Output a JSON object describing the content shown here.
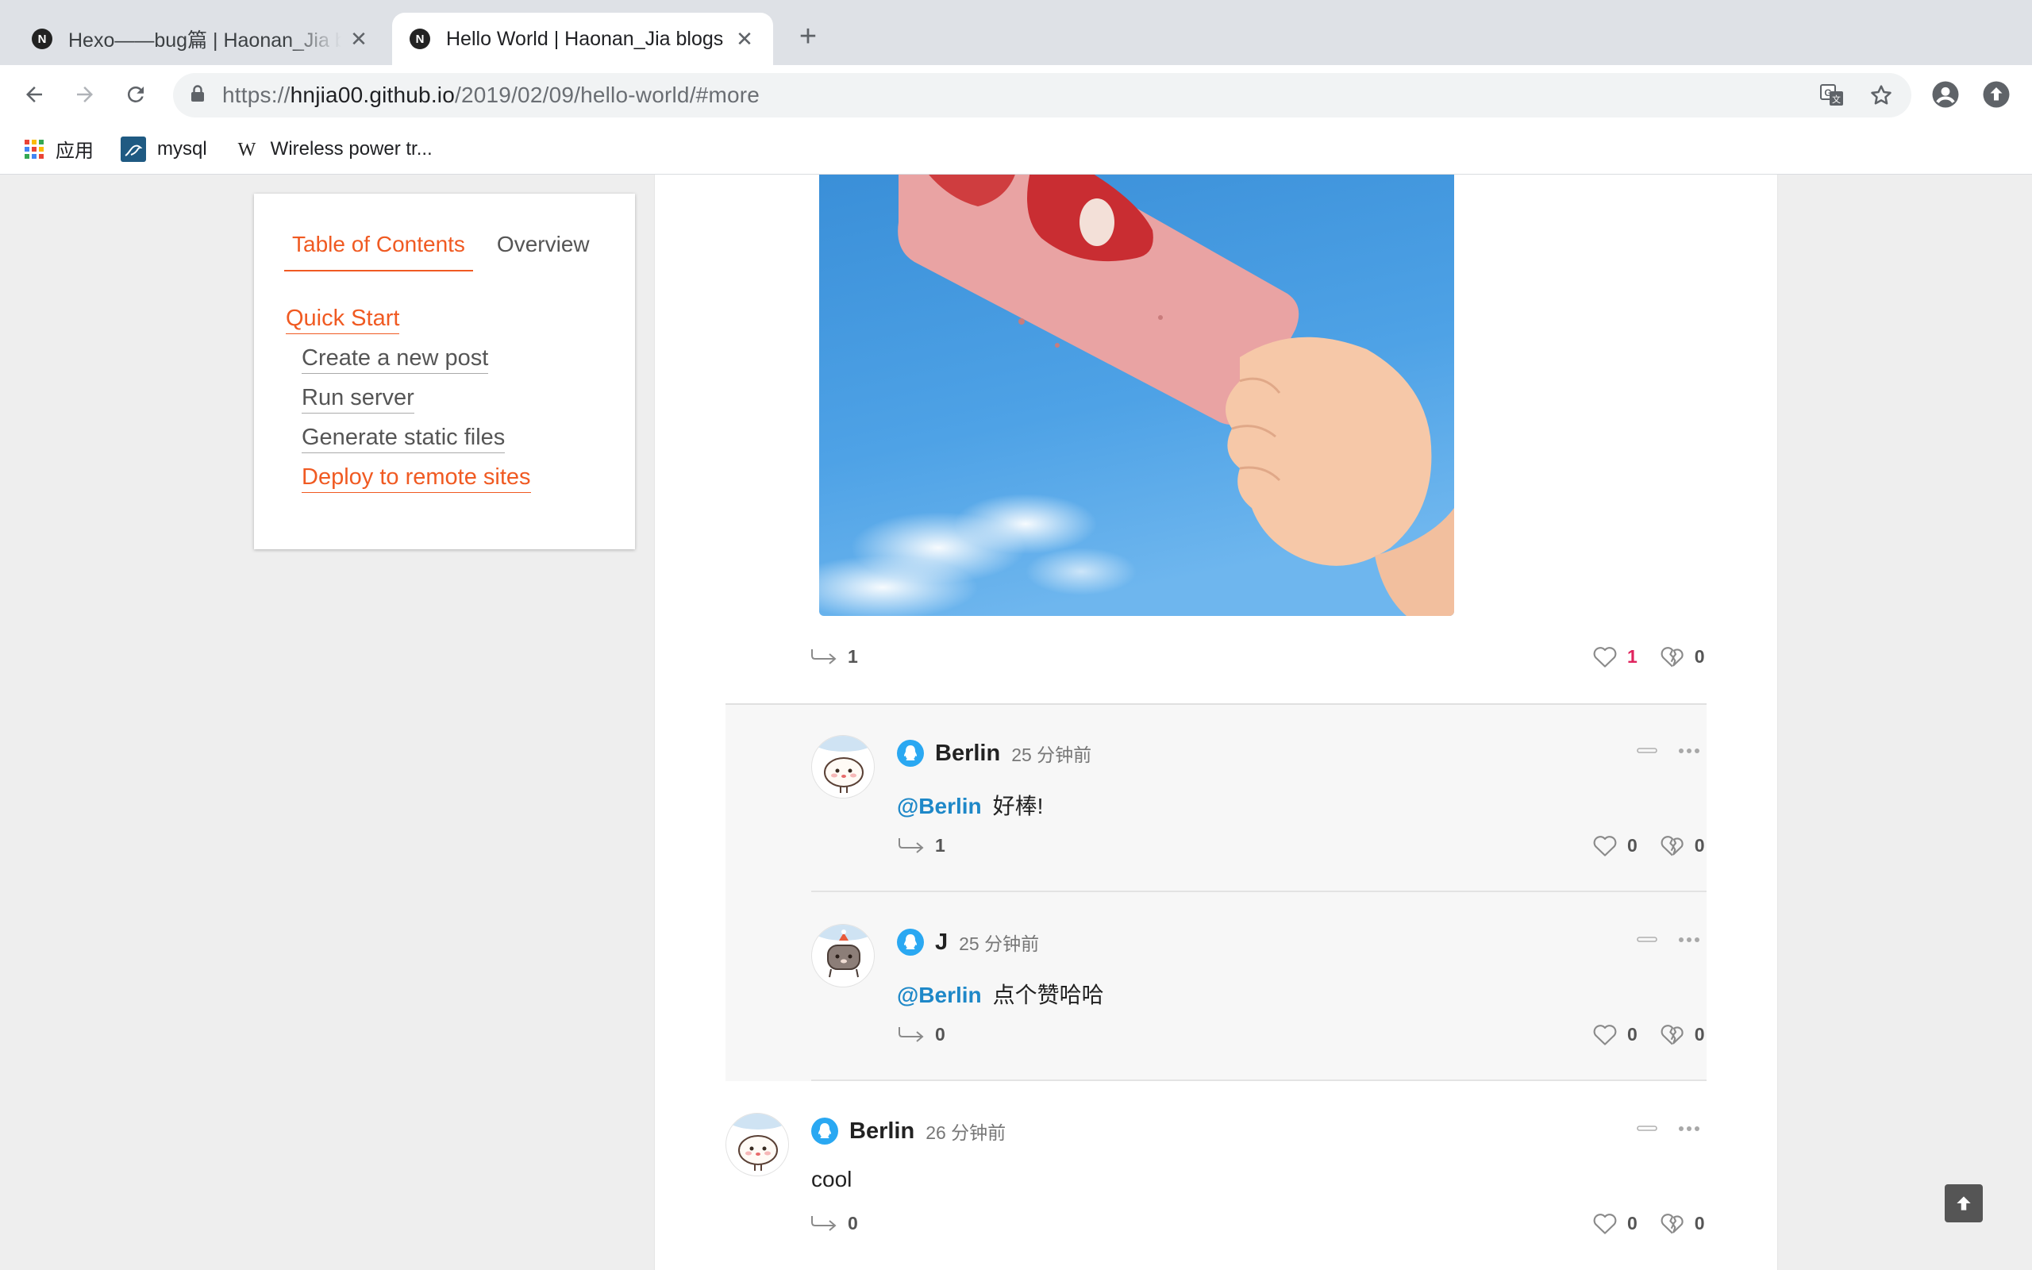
{
  "browser": {
    "tabs": [
      {
        "title": "Hexo——bug篇 | Haonan_Jia blogs",
        "favicon": "N",
        "close": "✕"
      },
      {
        "title": "Hello World | Haonan_Jia blogs",
        "favicon": "N",
        "close": "✕"
      }
    ],
    "new_tab": "+",
    "url": {
      "scheme": "https://",
      "host": "hnjia00.github.io",
      "path": "/2019/02/09/hello-world/#more"
    },
    "bookmarks": [
      {
        "label": "应用",
        "icon": "apps-grid-icon"
      },
      {
        "label": "mysql",
        "icon": "mysql-icon"
      },
      {
        "label": "Wireless power tr...",
        "icon": "wikipedia-icon"
      }
    ]
  },
  "toc": {
    "tabs": [
      "Table of Contents",
      "Overview"
    ],
    "items": [
      {
        "label": "Quick Start",
        "level": 1,
        "active": true
      },
      {
        "label": "Create a new post",
        "level": 2,
        "active": false
      },
      {
        "label": "Run server",
        "level": 2,
        "active": false
      },
      {
        "label": "Generate static files",
        "level": 2,
        "active": false
      },
      {
        "label": "Deploy to remote sites",
        "level": 2,
        "active": true
      }
    ]
  },
  "comments": {
    "parent": {
      "replies": "1",
      "likes": "1",
      "dislikes": "0"
    },
    "replies": [
      {
        "author": "Berlin",
        "time": "25 分钟前",
        "mention": "@Berlin",
        "text": "好棒!",
        "replies": "1",
        "likes": "0",
        "dislikes": "0"
      },
      {
        "author": "J",
        "time": "25 分钟前",
        "mention": "@Berlin",
        "text": "点个赞哈哈",
        "replies": "0",
        "likes": "0",
        "dislikes": "0"
      }
    ],
    "next": {
      "author": "Berlin",
      "time": "26 分钟前",
      "text": "cool",
      "replies": "0",
      "likes": "0",
      "dislikes": "0"
    }
  },
  "colors": {
    "accent": "#f05a22",
    "mention": "#1e88c8",
    "like_red": "#e0245e",
    "qq": "#2aa8f2"
  }
}
